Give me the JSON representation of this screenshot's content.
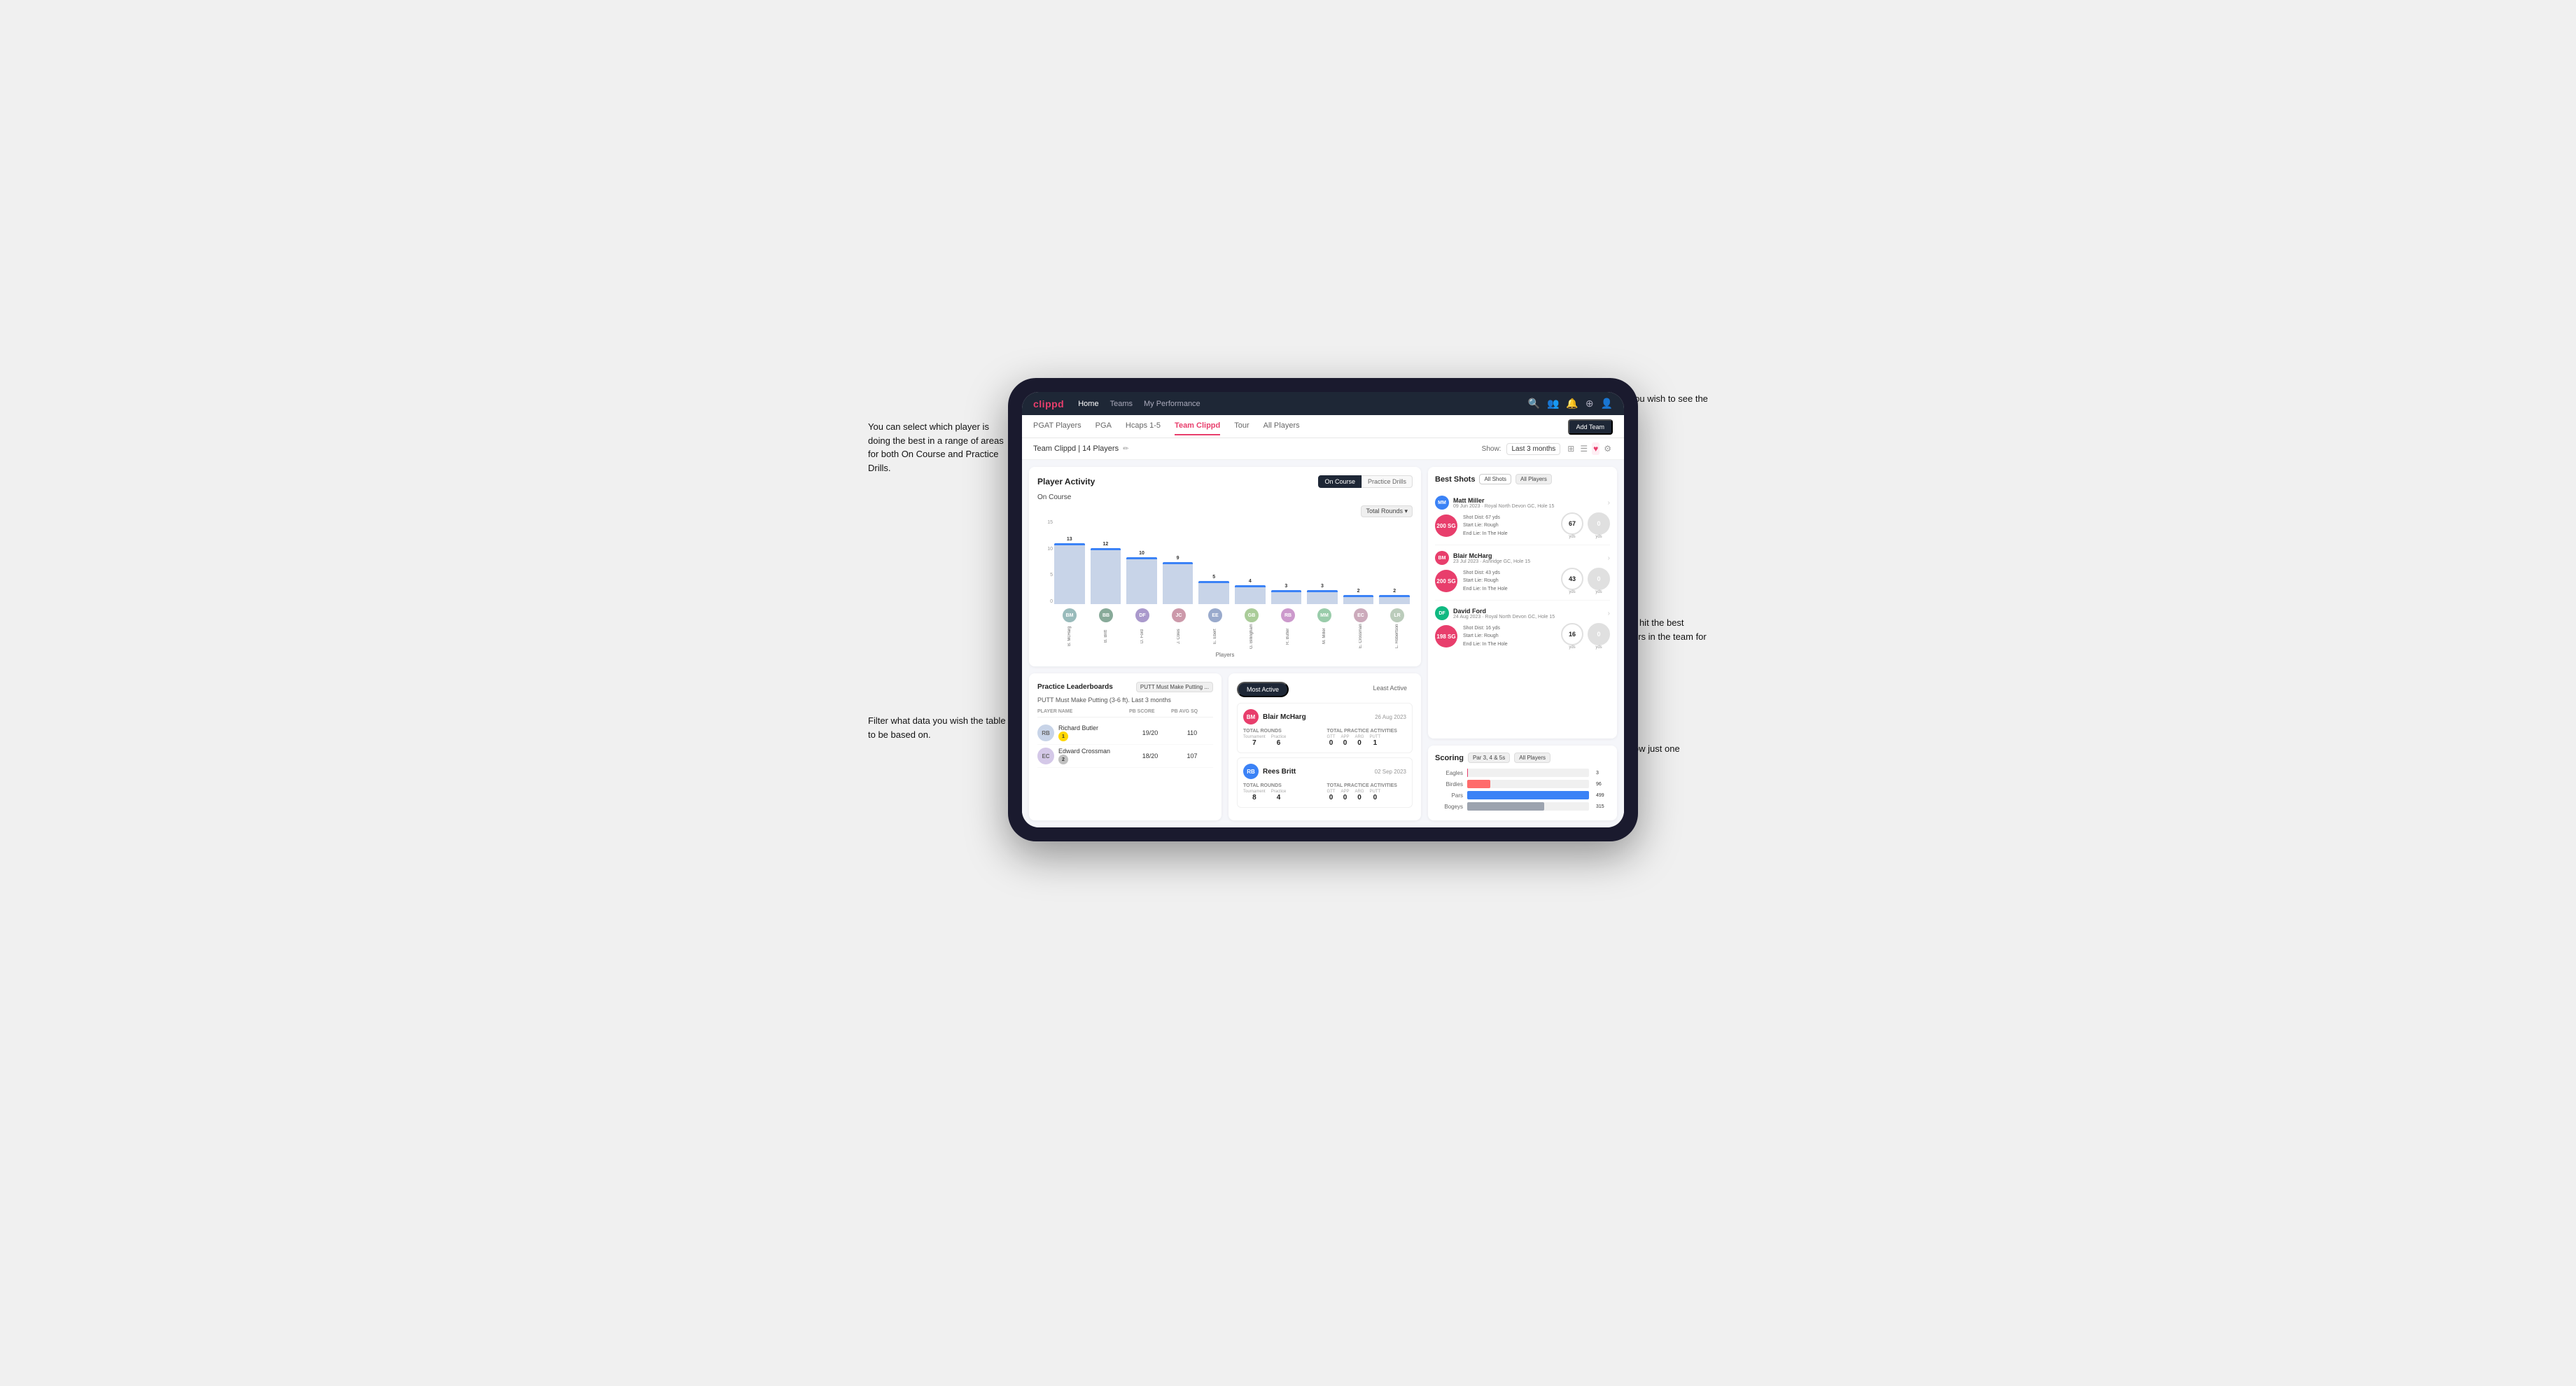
{
  "app": {
    "logo": "clippd",
    "nav": {
      "links": [
        "Home",
        "Teams",
        "My Performance"
      ],
      "icons": [
        "search",
        "users",
        "bell",
        "plus-circle",
        "user-circle"
      ]
    }
  },
  "subNav": {
    "items": [
      "PGAT Players",
      "PGA",
      "Hcaps 1-5",
      "Team Clippd",
      "Tour",
      "All Players"
    ],
    "activeItem": "Team Clippd",
    "addButton": "Add Team"
  },
  "teamHeader": {
    "teamName": "Team Clippd | 14 Players",
    "showLabel": "Show:",
    "showValue": "Last 3 months",
    "viewIcons": [
      "grid",
      "list",
      "heart",
      "settings"
    ]
  },
  "playerActivity": {
    "title": "Player Activity",
    "toggleButtons": [
      "On Course",
      "Practice Drills"
    ],
    "activeToggle": "On Course",
    "onCourseLabel": "On Course",
    "chartFilter": "Total Rounds",
    "xAxisLabel": "Players",
    "yAxisLabels": [
      "15",
      "10",
      "5",
      "0"
    ],
    "bars": [
      {
        "player": "B. McHarg",
        "value": 13,
        "initials": "BM",
        "color": "#9bb"
      },
      {
        "player": "B. Britt",
        "value": 12,
        "initials": "BB",
        "color": "#8a9"
      },
      {
        "player": "D. Ford",
        "value": 10,
        "initials": "DF",
        "color": "#a9c"
      },
      {
        "player": "J. Coles",
        "value": 9,
        "initials": "JC",
        "color": "#c9a"
      },
      {
        "player": "E. Ebert",
        "value": 5,
        "initials": "EE",
        "color": "#9ac"
      },
      {
        "player": "G. Billingham",
        "value": 4,
        "initials": "GB",
        "color": "#ac9"
      },
      {
        "player": "R. Butler",
        "value": 3,
        "initials": "RB",
        "color": "#c9c"
      },
      {
        "player": "M. Miller",
        "value": 3,
        "initials": "MM",
        "color": "#9ca"
      },
      {
        "player": "E. Crossman",
        "value": 2,
        "initials": "EC",
        "color": "#cab"
      },
      {
        "player": "L. Robertson",
        "value": 2,
        "initials": "LR",
        "color": "#bcb"
      }
    ]
  },
  "practiceLeaderboard": {
    "title": "Practice Leaderboards",
    "filter": "PUTT Must Make Putting ...",
    "subtitle": "PUTT Must Make Putting (3-6 ft). Last 3 months",
    "columns": [
      "Player Name",
      "PB Score",
      "PB Avg SQ"
    ],
    "players": [
      {
        "name": "Richard Butler",
        "rank": 1,
        "pbScore": "19/20",
        "pbAvgSq": "110",
        "initials": "RB"
      },
      {
        "name": "Edward Crossman",
        "rank": 2,
        "pbScore": "18/20",
        "pbAvgSq": "107",
        "initials": "EC"
      }
    ]
  },
  "mostActive": {
    "tabs": [
      "Most Active",
      "Least Active"
    ],
    "activeTab": "Most Active",
    "players": [
      {
        "name": "Blair McHarg",
        "date": "26 Aug 2023",
        "initials": "BM",
        "totalRounds": {
          "tournament": 7,
          "practice": 6
        },
        "totalPracticeActivities": {
          "gtt": 0,
          "app": 0,
          "arg": 0,
          "putt": 1
        }
      },
      {
        "name": "Rees Britt",
        "date": "02 Sep 2023",
        "initials": "RB",
        "totalRounds": {
          "tournament": 8,
          "practice": 4
        },
        "totalPracticeActivities": {
          "gtt": 0,
          "app": 0,
          "arg": 0,
          "putt": 0
        }
      }
    ]
  },
  "bestShots": {
    "title": "Best Shots",
    "filters": [
      "All Shots",
      "All Players"
    ],
    "shots": [
      {
        "playerName": "Matt Miller",
        "playerDetail": "09 Jun 2023 · Royal North Devon GC, Hole 15",
        "initials": "MM",
        "avatarColor": "#3b82f6",
        "badge": "200 SG",
        "shotDist": "Shot Dist: 67 yds",
        "startLie": "Start Lie: Rough",
        "endLie": "End Lie: In The Hole",
        "metric1Val": "67",
        "metric1Unit": "yds",
        "metric2Val": "0",
        "metric2Unit": "yds"
      },
      {
        "playerName": "Blair McHarg",
        "playerDetail": "23 Jul 2023 · Ashridge GC, Hole 15",
        "initials": "BM",
        "avatarColor": "#e83e6c",
        "badge": "200 SG",
        "shotDist": "Shot Dist: 43 yds",
        "startLie": "Start Lie: Rough",
        "endLie": "End Lie: In The Hole",
        "metric1Val": "43",
        "metric1Unit": "yds",
        "metric2Val": "0",
        "metric2Unit": "yds"
      },
      {
        "playerName": "David Ford",
        "playerDetail": "24 Aug 2023 · Royal North Devon GC, Hole 15",
        "initials": "DF",
        "avatarColor": "#10b981",
        "badge": "198 SG",
        "shotDist": "Shot Dist: 16 yds",
        "startLie": "Start Lie: Rough",
        "endLie": "End Lie: In The Hole",
        "metric1Val": "16",
        "metric1Unit": "yds",
        "metric2Val": "0",
        "metric2Unit": "yds"
      }
    ]
  },
  "scoring": {
    "title": "Scoring",
    "filters": [
      "Par 3, 4 & 5s",
      "All Players"
    ],
    "rows": [
      {
        "label": "Eagles",
        "value": 3,
        "maxVal": 499,
        "colorClass": "scoring-bar-pink"
      },
      {
        "label": "Birdies",
        "value": 96,
        "maxVal": 499,
        "colorClass": "scoring-bar-red"
      },
      {
        "label": "Pars",
        "value": 499,
        "maxVal": 499,
        "colorClass": "scoring-bar-blue"
      },
      {
        "label": "Bogeys",
        "value": 315,
        "maxVal": 499,
        "colorClass": "scoring-bar-gray"
      }
    ]
  },
  "annotations": {
    "topLeft": "You can select which player is doing the best in a range of areas for both On Course and Practice Drills.",
    "bottomLeft": "Filter what data you wish the table to be based on.",
    "topRight": "Choose the timescale you wish to see the data over.",
    "middleRight": "Here you can see who's hit the best shots out of all the players in the team for each department.",
    "bottomRight": "You can also filter to show just one player's best shots."
  }
}
